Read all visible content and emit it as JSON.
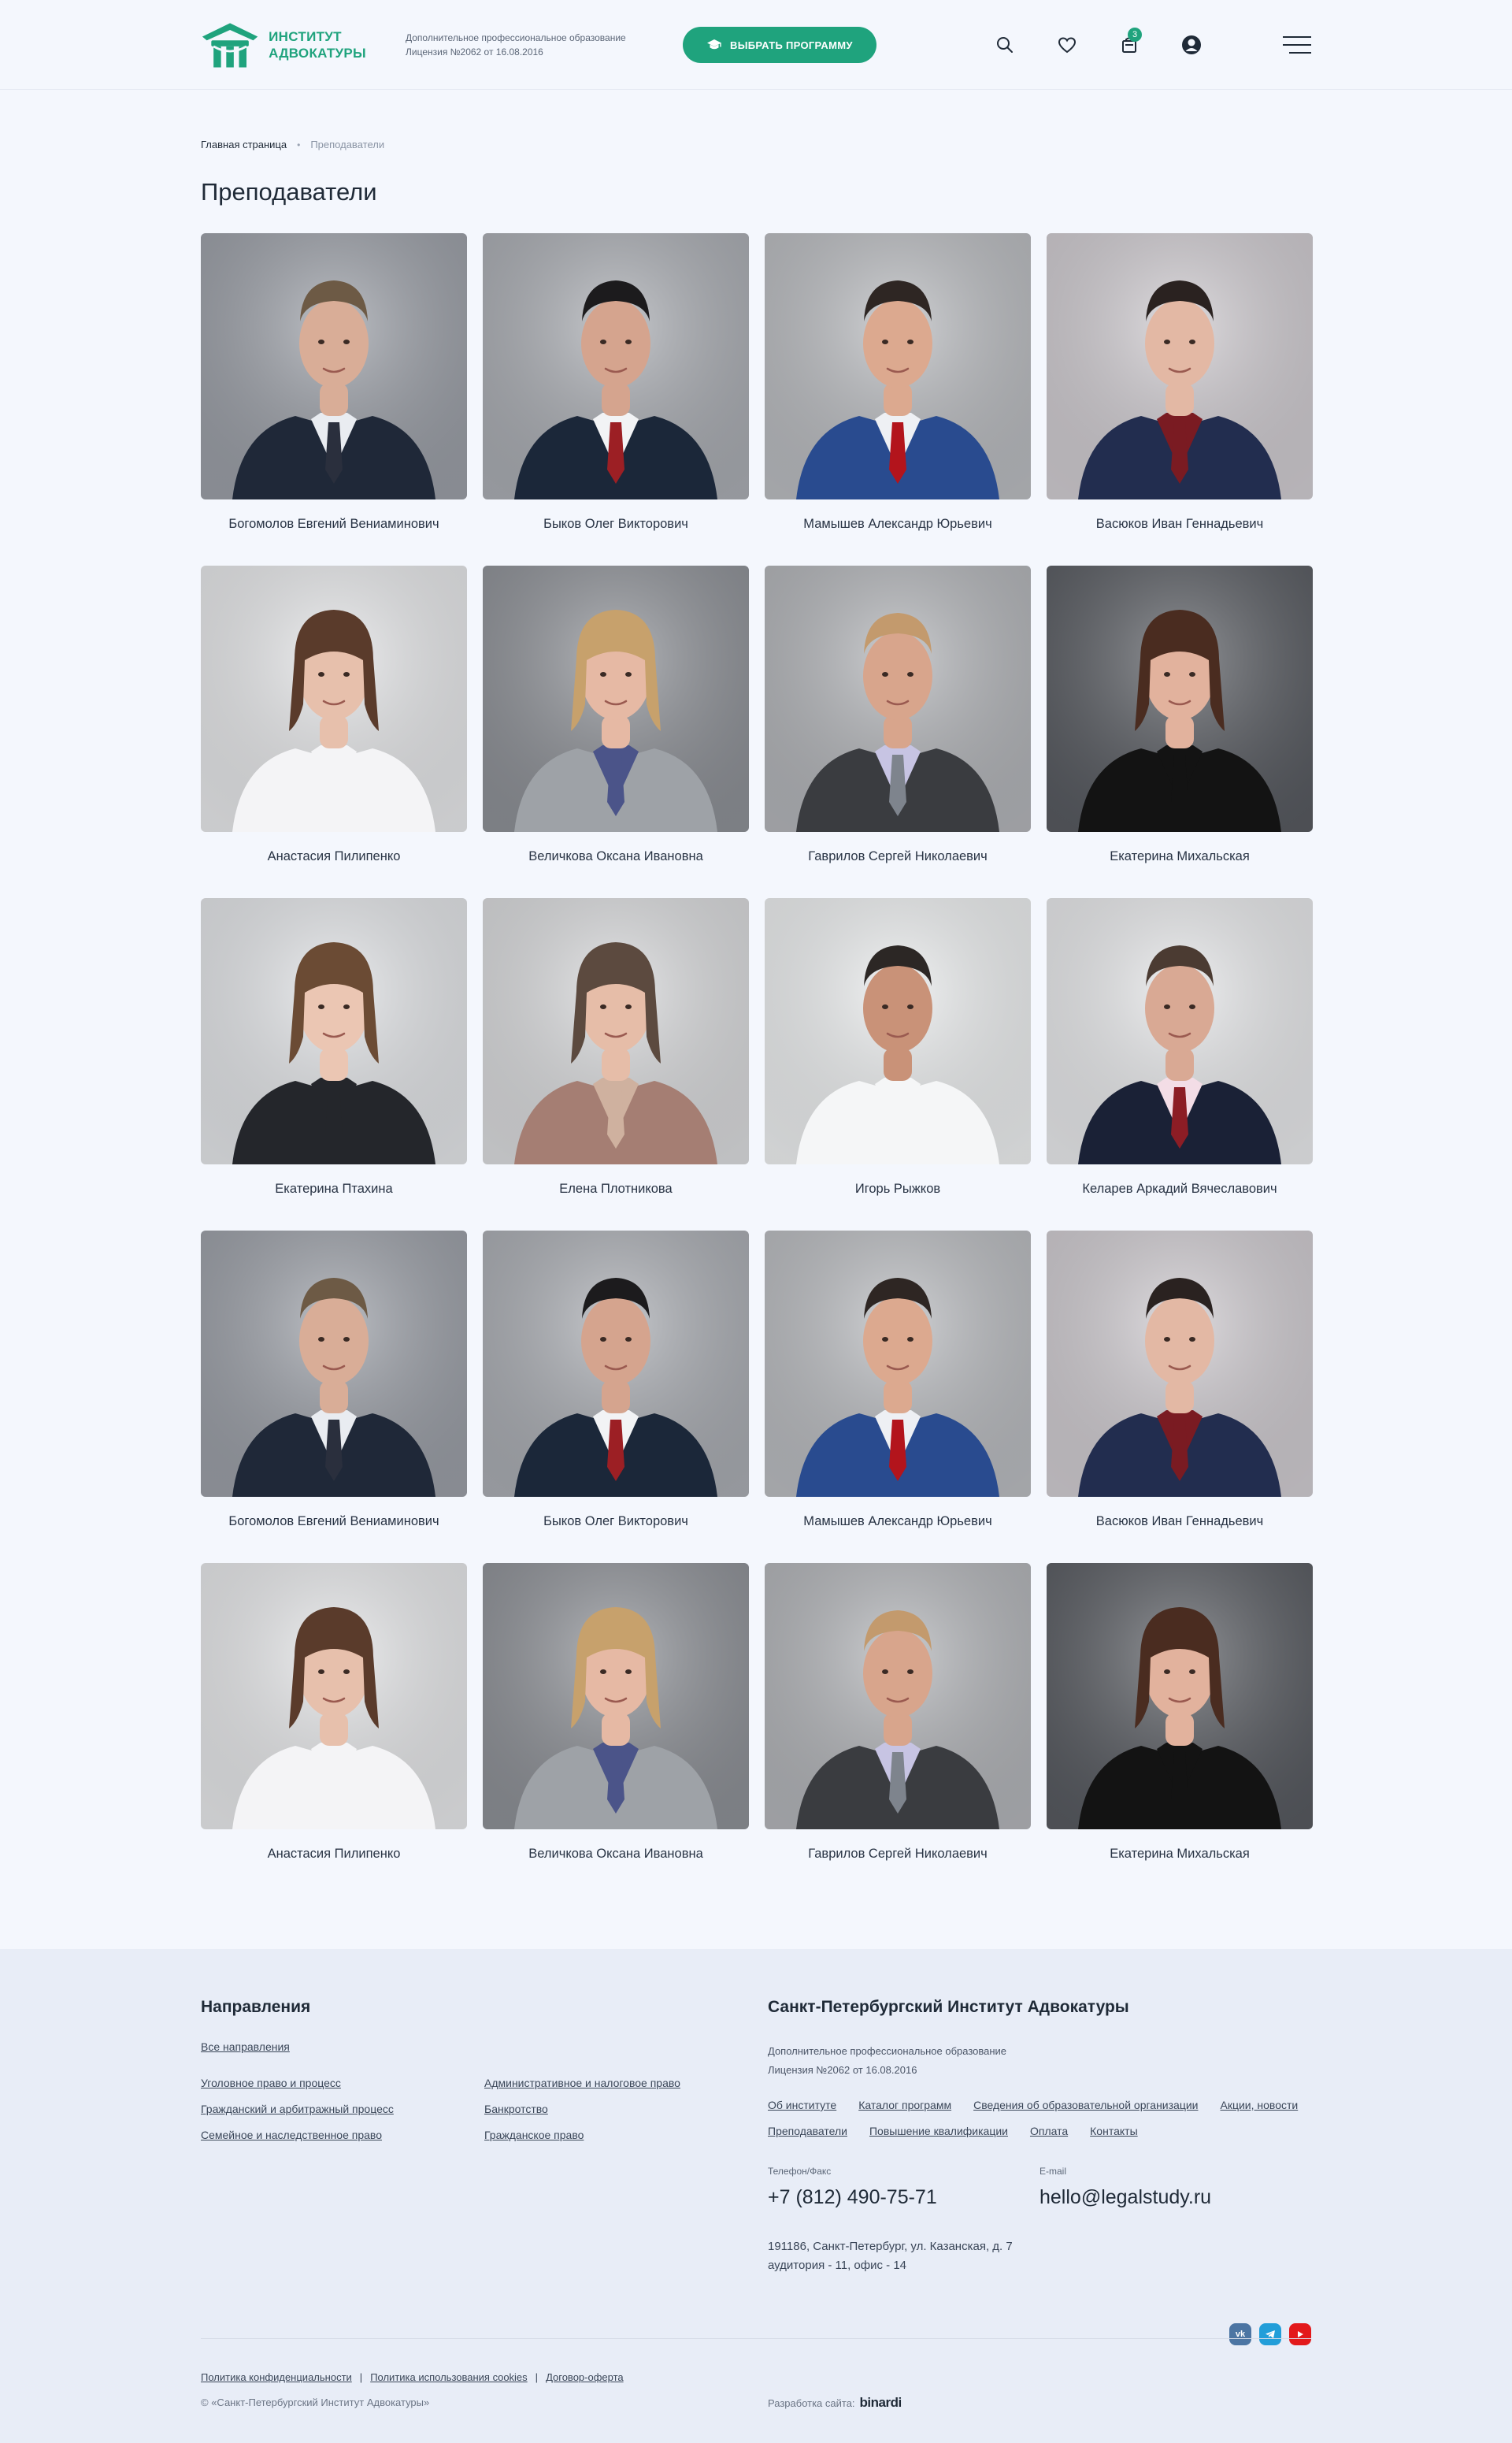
{
  "header": {
    "logo_line1": "ИНСТИТУТ",
    "logo_line2": "АДВОКАТУРЫ",
    "license_line1": "Дополнительное профессиональное образование",
    "license_line2": "Лицензия №2062 от 16.08.2016",
    "choose_button": "ВЫБРАТЬ ПРОГРАММУ",
    "cart_count": "3",
    "icons": [
      "search-icon",
      "heart-icon",
      "cart-icon",
      "user-icon",
      "menu-icon"
    ]
  },
  "breadcrumb": {
    "home": "Главная страница",
    "separator": "•",
    "current": "Преподаватели"
  },
  "page_title": "Преподаватели",
  "teachers": [
    {
      "name": "Богомолов Евгений Вениаминович",
      "bg": "#9a9ea6",
      "hair": "#6d5a45",
      "skin": "#d9ad97",
      "suit": "#1f2838",
      "tie": "#2a2f3d",
      "shirt": "#e9ecf1"
    },
    {
      "name": "Быков Олег Викторович",
      "bg": "#a9acb2",
      "hair": "#1c1b1d",
      "skin": "#d5a48e",
      "suit": "#1b2739",
      "tie": "#9c1f24",
      "shirt": "#f2f3f5"
    },
    {
      "name": "Мамышев Александр Юрьевич",
      "bg": "#b9bbbf",
      "hair": "#2e2623",
      "skin": "#dca98f",
      "suit": "#294b8f",
      "tie": "#b3141c",
      "shirt": "#eef0f4"
    },
    {
      "name": "Васюков Иван Геннадьевич",
      "bg": "#cfcbd0",
      "hair": "#2a2220",
      "skin": "#e3b8a4",
      "suit": "#222d4f",
      "tie": "#7a1b22",
      "shirt": "#7a1b22"
    },
    {
      "name": "Анастасия Пилипенко",
      "bg": "#e6e7e9",
      "hair": "#5a3b2b",
      "skin": "#e7c0ac",
      "suit": "#f4f4f6",
      "tie": "#f4f4f6",
      "shirt": "#f4f4f6"
    },
    {
      "name": "Величкова Оксана Ивановна",
      "bg": "#8d9096",
      "hair": "#c7a16c",
      "skin": "#e6b9a4",
      "suit": "#9ea2a7",
      "tie": "#4b5489",
      "shirt": "#4b5489"
    },
    {
      "name": "Гаврилов Сергей Николаевич",
      "bg": "#b2b4b8",
      "hair": "#c39a6d",
      "skin": "#d8a58c",
      "suit": "#3a3c40",
      "tie": "#7e848d",
      "shirt": "#c7c4e3"
    },
    {
      "name": "Екатерина Михальская",
      "bg": "#575a60",
      "hair": "#4a2c20",
      "skin": "#e2b29d",
      "suit": "#131313",
      "tie": "#131313",
      "shirt": "#131313"
    },
    {
      "name": "Екатерина Птахина",
      "bg": "#e2e4e7",
      "hair": "#6b4b34",
      "skin": "#ebc6b3",
      "suit": "#24262b",
      "tie": "#24262b",
      "shirt": "#24262b"
    },
    {
      "name": "Елена Плотникова",
      "bg": "#d9dadc",
      "hair": "#5c4a3f",
      "skin": "#e6bda8",
      "suit": "#a57e73",
      "tie": "#cfb19f",
      "shirt": "#cfb19f"
    },
    {
      "name": "Игорь Рыжков",
      "bg": "#eceeef",
      "hair": "#2c2725",
      "skin": "#c99278",
      "suit": "#f5f6f7",
      "tie": "#f5f6f7",
      "shirt": "#f5f6f7"
    },
    {
      "name": "Келарев Аркадий Вячеславович",
      "bg": "#e7e8ea",
      "hair": "#4b3b32",
      "skin": "#d9a994",
      "suit": "#1a2136",
      "tie": "#8c1d25",
      "shirt": "#f3dde6"
    },
    {
      "name": "Богомолов Евгений Вениаминович",
      "bg": "#9a9ea6",
      "hair": "#6d5a45",
      "skin": "#d9ad97",
      "suit": "#1f2838",
      "tie": "#2a2f3d",
      "shirt": "#e9ecf1"
    },
    {
      "name": "Быков Олег Викторович",
      "bg": "#a9acb2",
      "hair": "#1c1b1d",
      "skin": "#d5a48e",
      "suit": "#1b2739",
      "tie": "#9c1f24",
      "shirt": "#f2f3f5"
    },
    {
      "name": "Мамышев Александр Юрьевич",
      "bg": "#b9bbbf",
      "hair": "#2e2623",
      "skin": "#dca98f",
      "suit": "#294b8f",
      "tie": "#b3141c",
      "shirt": "#eef0f4"
    },
    {
      "name": "Васюков Иван Геннадьевич",
      "bg": "#cfcbd0",
      "hair": "#2a2220",
      "skin": "#e3b8a4",
      "suit": "#222d4f",
      "tie": "#7a1b22",
      "shirt": "#7a1b22"
    },
    {
      "name": "Анастасия Пилипенко",
      "bg": "#e6e7e9",
      "hair": "#5a3b2b",
      "skin": "#e7c0ac",
      "suit": "#f4f4f6",
      "tie": "#f4f4f6",
      "shirt": "#f4f4f6"
    },
    {
      "name": "Величкова Оксана Ивановна",
      "bg": "#8d9096",
      "hair": "#c7a16c",
      "skin": "#e6b9a4",
      "suit": "#9ea2a7",
      "tie": "#4b5489",
      "shirt": "#4b5489"
    },
    {
      "name": "Гаврилов Сергей Николаевич",
      "bg": "#b2b4b8",
      "hair": "#c39a6d",
      "skin": "#d8a58c",
      "suit": "#3a3c40",
      "tie": "#7e848d",
      "shirt": "#c7c4e3"
    },
    {
      "name": "Екатерина Михальская",
      "bg": "#575a60",
      "hair": "#4a2c20",
      "skin": "#e2b29d",
      "suit": "#131313",
      "tie": "#131313",
      "shirt": "#131313"
    }
  ],
  "footer": {
    "directions_title": "Направления",
    "all_directions": "Все направления",
    "directions": [
      "Уголовное право и процесс",
      "Административное и налоговое право",
      "Гражданский и арбитражный процесс",
      "Банкротство",
      "Семейное и наследственное право",
      "Гражданское право"
    ],
    "institute_title": "Санкт-Петербургский Институт Адвокатуры",
    "license_line1": "Дополнительное профессиональное образование",
    "license_line2": "Лицензия №2062 от 16.08.2016",
    "nav": [
      "Об институте",
      "Каталог программ",
      "Сведения об образовательной организации",
      "Акции, новости",
      "Преподаватели",
      "Повышение квалификации",
      "Оплата",
      "Контакты"
    ],
    "phone_label": "Телефон/Факс",
    "phone": "+7 (812) 490-75-71",
    "email_label": "E-mail",
    "email": "hello@legalstudy.ru",
    "address_line1": "191186, Санкт-Петербург, ул. Казанская, д. 7",
    "address_line2": "аудитория - 11, офис - 14",
    "socials": [
      "vk-icon",
      "telegram-icon",
      "youtube-icon"
    ],
    "legal_links": [
      "Политика конфиденциальности",
      "Политика использования cookies",
      "Договор-оферта"
    ],
    "legal_sep": "|",
    "copyright": "© «Санкт-Петербургский Институт Адвокатуры»",
    "dev_label": "Разработка сайта:",
    "dev_name": "binardi"
  },
  "colors": {
    "brand": "#1fa37d",
    "page_bg": "#f4f7fd",
    "footer_bg": "#e8edf7",
    "text": "#1f2a37"
  }
}
